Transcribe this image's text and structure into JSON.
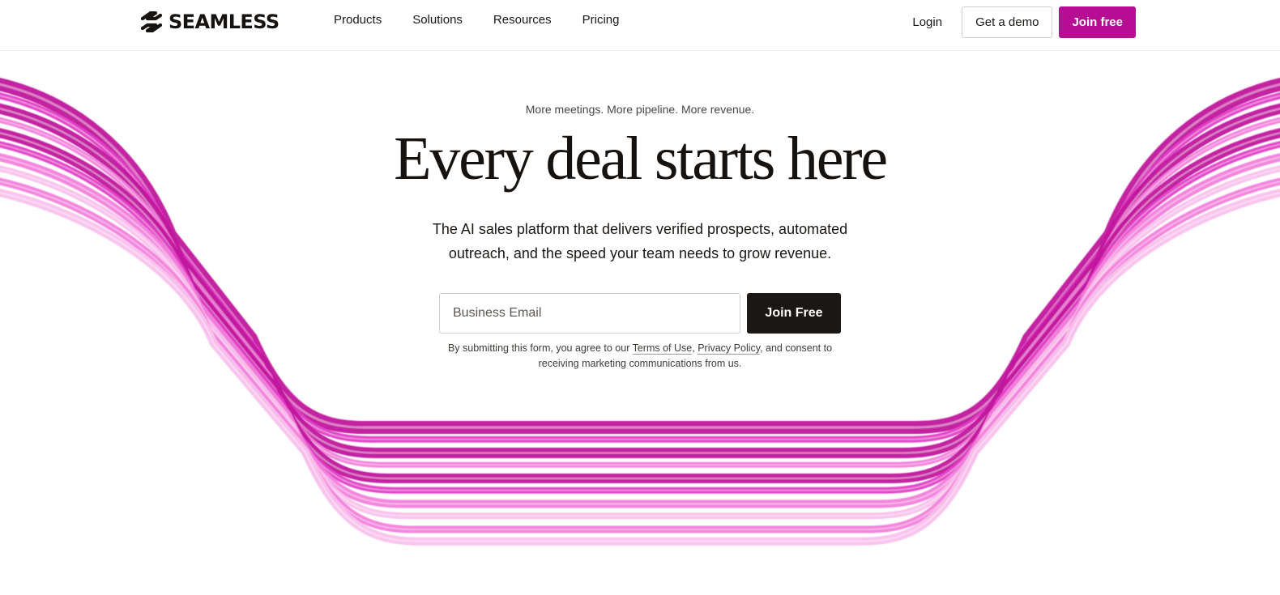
{
  "brand": {
    "name": "SEAMLESS",
    "accent_color": "#b80d92",
    "stripe_colors": [
      "#c0149c",
      "#e23fc6",
      "#f27fdb",
      "#f9c1ec"
    ]
  },
  "header": {
    "nav": [
      {
        "label": "Products"
      },
      {
        "label": "Solutions"
      },
      {
        "label": "Resources"
      },
      {
        "label": "Pricing"
      }
    ],
    "login_label": "Login",
    "demo_button_label": "Get a demo",
    "join_button_label": "Join free"
  },
  "hero": {
    "eyebrow": "More meetings. More pipeline. More revenue.",
    "headline": "Every deal starts here",
    "subhead": "The AI sales platform that delivers verified prospects, automated outreach, and the speed your team needs to grow revenue.",
    "form": {
      "email_placeholder": "Business Email",
      "email_value": "",
      "submit_label": "Join Free"
    },
    "consent": {
      "prefix": "By submitting this form, you agree to our ",
      "terms_label": "Terms of Use",
      "separator": ", ",
      "privacy_label": "Privacy Policy",
      "suffix": ", and consent to receiving marketing communications from us."
    }
  }
}
